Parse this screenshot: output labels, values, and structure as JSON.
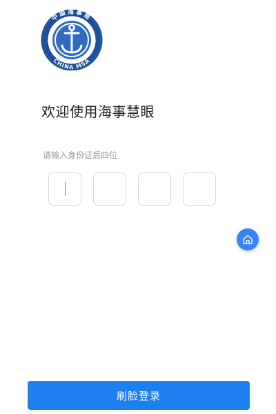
{
  "logo": {
    "top_text": "中国海事局",
    "bottom_text": "CHINA MSA",
    "colors": {
      "ring": "#1d4f9c",
      "inner": "#2f6bbf",
      "fill": "#ffffff"
    },
    "icon": "anchor-icon"
  },
  "welcome_title": "欢迎使用海事慧眼",
  "id_prompt": "请输入身份证后四位",
  "code_inputs": [
    "",
    "",
    "",
    ""
  ],
  "home_button": {
    "icon": "home-icon",
    "color": "#3b82f6"
  },
  "login_button": {
    "label": "刷脸登录",
    "color": "#1e80f0"
  }
}
